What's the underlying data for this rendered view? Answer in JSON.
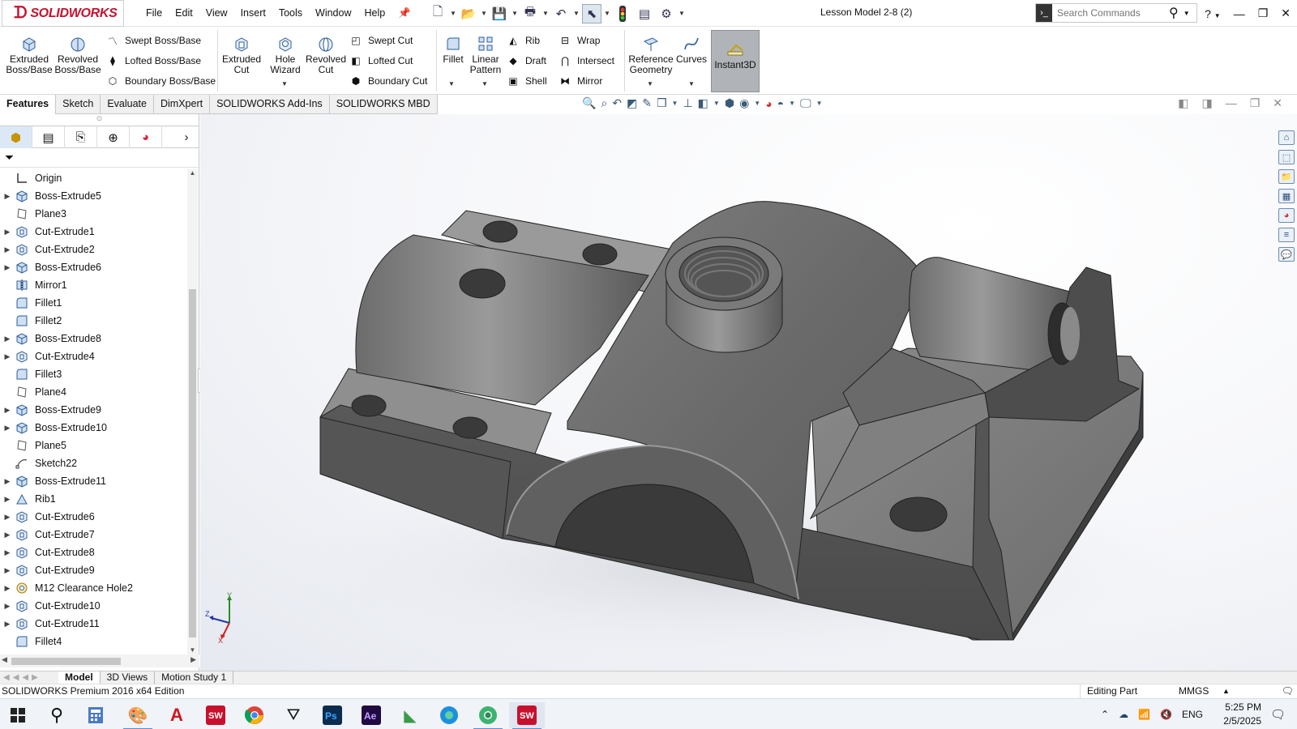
{
  "titlebar": {
    "logo_text": "SOLIDWORKS",
    "menu": [
      "File",
      "Edit",
      "View",
      "Insert",
      "Tools",
      "Window",
      "Help"
    ],
    "document_title": "Lesson Model 2-8 (2)",
    "search_placeholder": "Search Commands",
    "help_label": "?"
  },
  "command_manager": {
    "extruded_boss": "Extruded\nBoss/Base",
    "revolved_boss": "Revolved\nBoss/Base",
    "swept_boss": "Swept Boss/Base",
    "lofted_boss": "Lofted Boss/Base",
    "boundary_boss": "Boundary Boss/Base",
    "extruded_cut": "Extruded\nCut",
    "hole_wizard": "Hole\nWizard",
    "revolved_cut": "Revolved\nCut",
    "swept_cut": "Swept Cut",
    "lofted_cut": "Lofted Cut",
    "boundary_cut": "Boundary Cut",
    "fillet": "Fillet",
    "linear_pattern": "Linear\nPattern",
    "rib": "Rib",
    "draft": "Draft",
    "shell": "Shell",
    "wrap": "Wrap",
    "intersect": "Intersect",
    "mirror": "Mirror",
    "reference_geometry": "Reference\nGeometry",
    "curves": "Curves",
    "instant3d": "Instant3D"
  },
  "tabs": [
    "Features",
    "Sketch",
    "Evaluate",
    "DimXpert",
    "SOLIDWORKS Add-Ins",
    "SOLIDWORKS MBD"
  ],
  "active_tab": "Features",
  "feature_tree": [
    {
      "label": "Origin",
      "icon": "origin-icon",
      "expandable": false
    },
    {
      "label": "Boss-Extrude5",
      "icon": "boss-extrude-icon",
      "expandable": true
    },
    {
      "label": "Plane3",
      "icon": "plane-icon",
      "expandable": false
    },
    {
      "label": "Cut-Extrude1",
      "icon": "cut-extrude-icon",
      "expandable": true
    },
    {
      "label": "Cut-Extrude2",
      "icon": "cut-extrude-icon",
      "expandable": true
    },
    {
      "label": "Boss-Extrude6",
      "icon": "boss-extrude-icon",
      "expandable": true
    },
    {
      "label": "Mirror1",
      "icon": "mirror-icon",
      "expandable": false
    },
    {
      "label": "Fillet1",
      "icon": "fillet-icon",
      "expandable": false
    },
    {
      "label": "Fillet2",
      "icon": "fillet-icon",
      "expandable": false
    },
    {
      "label": "Boss-Extrude8",
      "icon": "boss-extrude-icon",
      "expandable": true
    },
    {
      "label": "Cut-Extrude4",
      "icon": "cut-extrude-icon",
      "expandable": true
    },
    {
      "label": "Fillet3",
      "icon": "fillet-icon",
      "expandable": false
    },
    {
      "label": "Plane4",
      "icon": "plane-icon",
      "expandable": false
    },
    {
      "label": "Boss-Extrude9",
      "icon": "boss-extrude-icon",
      "expandable": true
    },
    {
      "label": "Boss-Extrude10",
      "icon": "boss-extrude-icon",
      "expandable": true
    },
    {
      "label": "Plane5",
      "icon": "plane-icon",
      "expandable": false
    },
    {
      "label": "Sketch22",
      "icon": "sketch-icon",
      "expandable": false
    },
    {
      "label": "Boss-Extrude11",
      "icon": "boss-extrude-icon",
      "expandable": true
    },
    {
      "label": "Rib1",
      "icon": "rib-icon",
      "expandable": true
    },
    {
      "label": "Cut-Extrude6",
      "icon": "cut-extrude-icon",
      "expandable": true
    },
    {
      "label": "Cut-Extrude7",
      "icon": "cut-extrude-icon",
      "expandable": true
    },
    {
      "label": "Cut-Extrude8",
      "icon": "cut-extrude-icon",
      "expandable": true
    },
    {
      "label": "Cut-Extrude9",
      "icon": "cut-extrude-icon",
      "expandable": true
    },
    {
      "label": "M12 Clearance Hole2",
      "icon": "hole-wizard-icon",
      "expandable": true
    },
    {
      "label": "Cut-Extrude10",
      "icon": "cut-extrude-icon",
      "expandable": true
    },
    {
      "label": "Cut-Extrude11",
      "icon": "cut-extrude-icon",
      "expandable": true
    },
    {
      "label": "Fillet4",
      "icon": "fillet-icon",
      "expandable": false
    }
  ],
  "bottom_tabs": [
    "Model",
    "3D Views",
    "Motion Study 1"
  ],
  "active_bottom_tab": "Model",
  "status": {
    "left": "SOLIDWORKS Premium 2016 x64 Edition",
    "mode": "Editing Part",
    "units": "MMGS"
  },
  "triad": {
    "x": "X",
    "y": "Y",
    "z": "Z"
  },
  "taskbar": {
    "apps": [
      "windows-start",
      "search",
      "calculator",
      "paint",
      "acrobat",
      "solidworks-2016",
      "chrome",
      "inkscape",
      "photoshop",
      "after-effects",
      "maps",
      "edge",
      "chromium",
      "solidworks-2016-active"
    ],
    "lang": "ENG",
    "time": "5:25 PM",
    "date": "2/5/2025"
  },
  "colors": {
    "brand": "#c8102e",
    "part": "#5a5a5a",
    "accent": "#5b8bd5"
  }
}
